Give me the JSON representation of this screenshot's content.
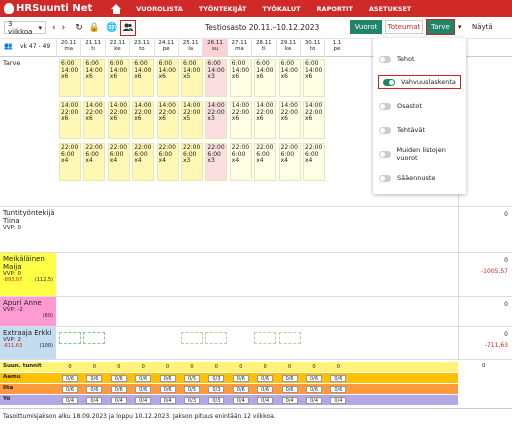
{
  "app": {
    "name": "HRSuunti Net"
  },
  "nav": [
    "VUOROLISTA",
    "TYÖNTEKIJÄT",
    "TYÖKALUT",
    "RAPORTIT",
    "ASETUKSET"
  ],
  "toolbar": {
    "range": "3 viikkoa",
    "title": "Testiosasto 20.11.–10.12.2023",
    "btn_vuorot": "Vuorot",
    "btn_toteumat": "Toteumat",
    "btn_tarve": "Tarve",
    "btn_nayta": "Näytä"
  },
  "week_label": "vk 47 - 49",
  "dates": [
    [
      "20.11",
      "ma"
    ],
    [
      "21.11",
      "ti"
    ],
    [
      "22.11",
      "ke"
    ],
    [
      "23.11",
      "to"
    ],
    [
      "24.11",
      "pe"
    ],
    [
      "25.11",
      "la"
    ],
    [
      "26.11",
      "su"
    ],
    [
      "27.11",
      "ma"
    ],
    [
      "28.11",
      "ti"
    ],
    [
      "29.11",
      "ke"
    ],
    [
      "30.11",
      "to"
    ],
    [
      "1.1",
      "pe"
    ]
  ],
  "tarve": {
    "label": "Tarve",
    "blocks": [
      [
        "6:00",
        "14:00",
        "x6"
      ],
      [
        "14:00",
        "22:00",
        "x6"
      ],
      [
        "22:00",
        "6:00",
        "x4"
      ]
    ]
  },
  "sat_counts": [
    "x5",
    "x5",
    "x3"
  ],
  "sun_counts": [
    "x3",
    "x3",
    "x3"
  ],
  "rows": [
    {
      "name": "Tuntityöntekijä",
      "name2": "Tiina",
      "vvp": "VVP: 0",
      "right": "0",
      "color": "#ffffff"
    },
    {
      "name": "Meikäläinen",
      "name2": "Maija",
      "vvp": "VVP: 0",
      "sub": "-893,07",
      "sub2": "(112,5)",
      "right": "0",
      "right2": "-1005,57",
      "color": "#ffff46"
    },
    {
      "name": "Apuri Anne",
      "vvp": "VVP: -2",
      "sub2": "(60)",
      "right": "0",
      "color": "#ff9ad2"
    },
    {
      "name": "Extraaja Erkki",
      "vvp": "VVP: 2",
      "sub": "-611,63",
      "sub2": "(100)",
      "right": "0",
      "right2": "-711,63",
      "color": "#c4dcf0"
    }
  ],
  "summary": [
    {
      "label": "Suun. tunnit",
      "color": "#fff37a",
      "values": [
        "0",
        "0",
        "0",
        "0",
        "0",
        "0",
        "0",
        "0",
        "0",
        "0",
        "0",
        "0"
      ],
      "right": "0"
    },
    {
      "label": "Aamu",
      "color": "#ffc000",
      "values": [
        "0/6",
        "0/6",
        "0/6",
        "0/6",
        "0/6",
        "0/5",
        "0/3",
        "0/6",
        "0/6",
        "0/6",
        "0/6",
        "0/6"
      ],
      "right": ""
    },
    {
      "label": "Ilta",
      "color": "#ff9a3c",
      "values": [
        "0/6",
        "0/6",
        "0/6",
        "0/6",
        "0/6",
        "0/5",
        "0/3",
        "0/6",
        "0/6",
        "0/6",
        "0/6",
        "0/6"
      ],
      "right": ""
    },
    {
      "label": "Yö",
      "color": "#b4a7e6",
      "values": [
        "0/4",
        "0/4",
        "0/4",
        "0/4",
        "0/4",
        "0/3",
        "0/3",
        "0/4",
        "0/4",
        "0/4",
        "0/4",
        "0/4"
      ],
      "right": ""
    }
  ],
  "dropdown": [
    {
      "label": "Tehot",
      "on": false
    },
    {
      "label": "Vahvuuslaskenta",
      "on": true
    },
    {
      "label": "Osastot",
      "on": false
    },
    {
      "label": "Tehtävät",
      "on": false
    },
    {
      "label": "Muiden listojen vuorot",
      "on": false
    },
    {
      "label": "Sääennuste",
      "on": false
    }
  ],
  "footer": "Tasoittumisjakson alku 18.09.2023 ja loppu 10.12.2023. Jakson pituus enintään 12 viikkoa."
}
